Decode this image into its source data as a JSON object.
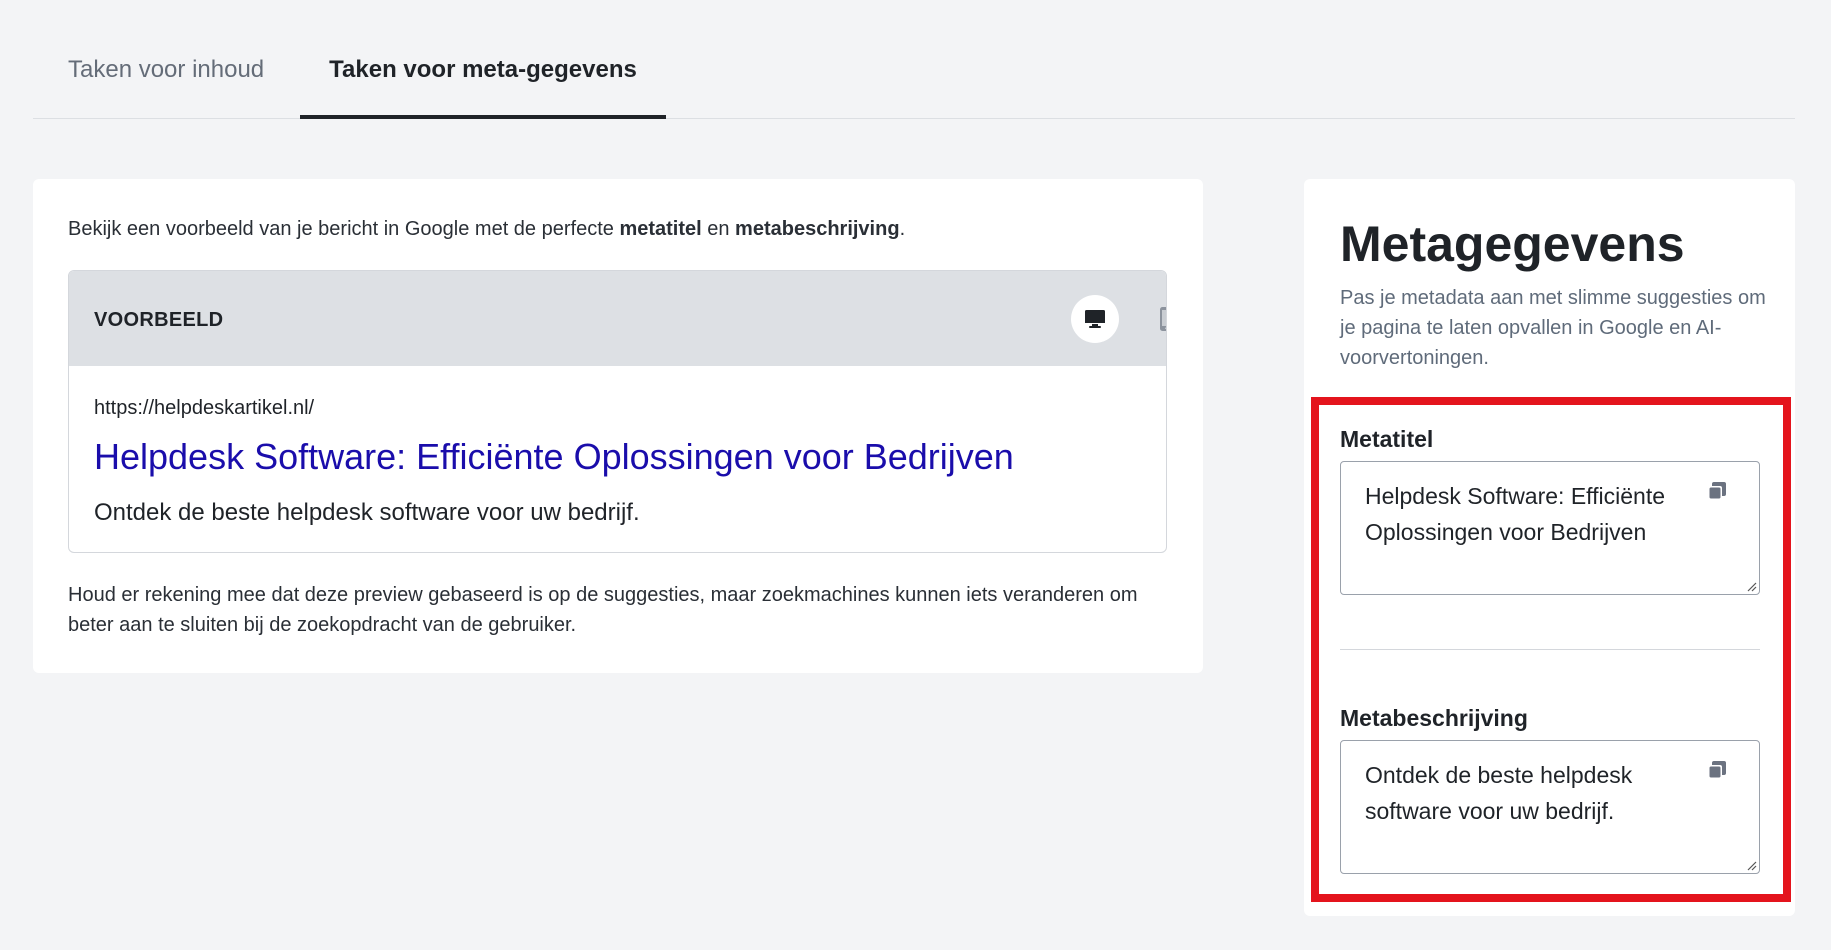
{
  "tabs": [
    {
      "label": "Taken voor inhoud",
      "active": false
    },
    {
      "label": "Taken voor meta-gegevens",
      "active": true
    }
  ],
  "preview_card": {
    "intro_prefix": "Bekijk een voorbeeld van je bericht in Google met de perfecte ",
    "intro_bold_1": "metatitel",
    "intro_mid": " en ",
    "intro_bold_2": "metabeschrijving",
    "intro_suffix": ".",
    "preview_label": "VOORBEELD",
    "devices": [
      {
        "icon": "desktop-icon",
        "active": true
      },
      {
        "icon": "mobile-icon",
        "active": false
      }
    ],
    "serp_url": "https://helpdeskartikel.nl/",
    "serp_title": "Helpdesk Software: Efficiënte Oplossingen voor Bedrijven",
    "serp_description": "Ontdek de beste helpdesk software voor uw bedrijf.",
    "note": "Houd er rekening mee dat deze preview gebaseerd is op de suggesties, maar zoekmachines kunnen iets veranderen om beter aan te sluiten bij de zoekopdracht van de gebruiker."
  },
  "meta_panel": {
    "heading": "Metagegevens",
    "subtitle": "Pas je metadata aan met slimme suggesties om je pagina te laten opvallen in Google en AI-voorvertoningen.",
    "meta_title_label": "Metatitel",
    "meta_title_value": "Helpdesk Software: Efficiënte Oplossingen voor Bedrijven",
    "meta_description_label": "Metabeschrijving",
    "meta_description_value": "Ontdek de beste helpdesk software voor uw bedrijf."
  },
  "colors": {
    "link_blue": "#1a0dab",
    "highlight_red": "#e4141d",
    "preview_header_bg": "#dde0e4",
    "page_bg": "#f3f4f6"
  }
}
